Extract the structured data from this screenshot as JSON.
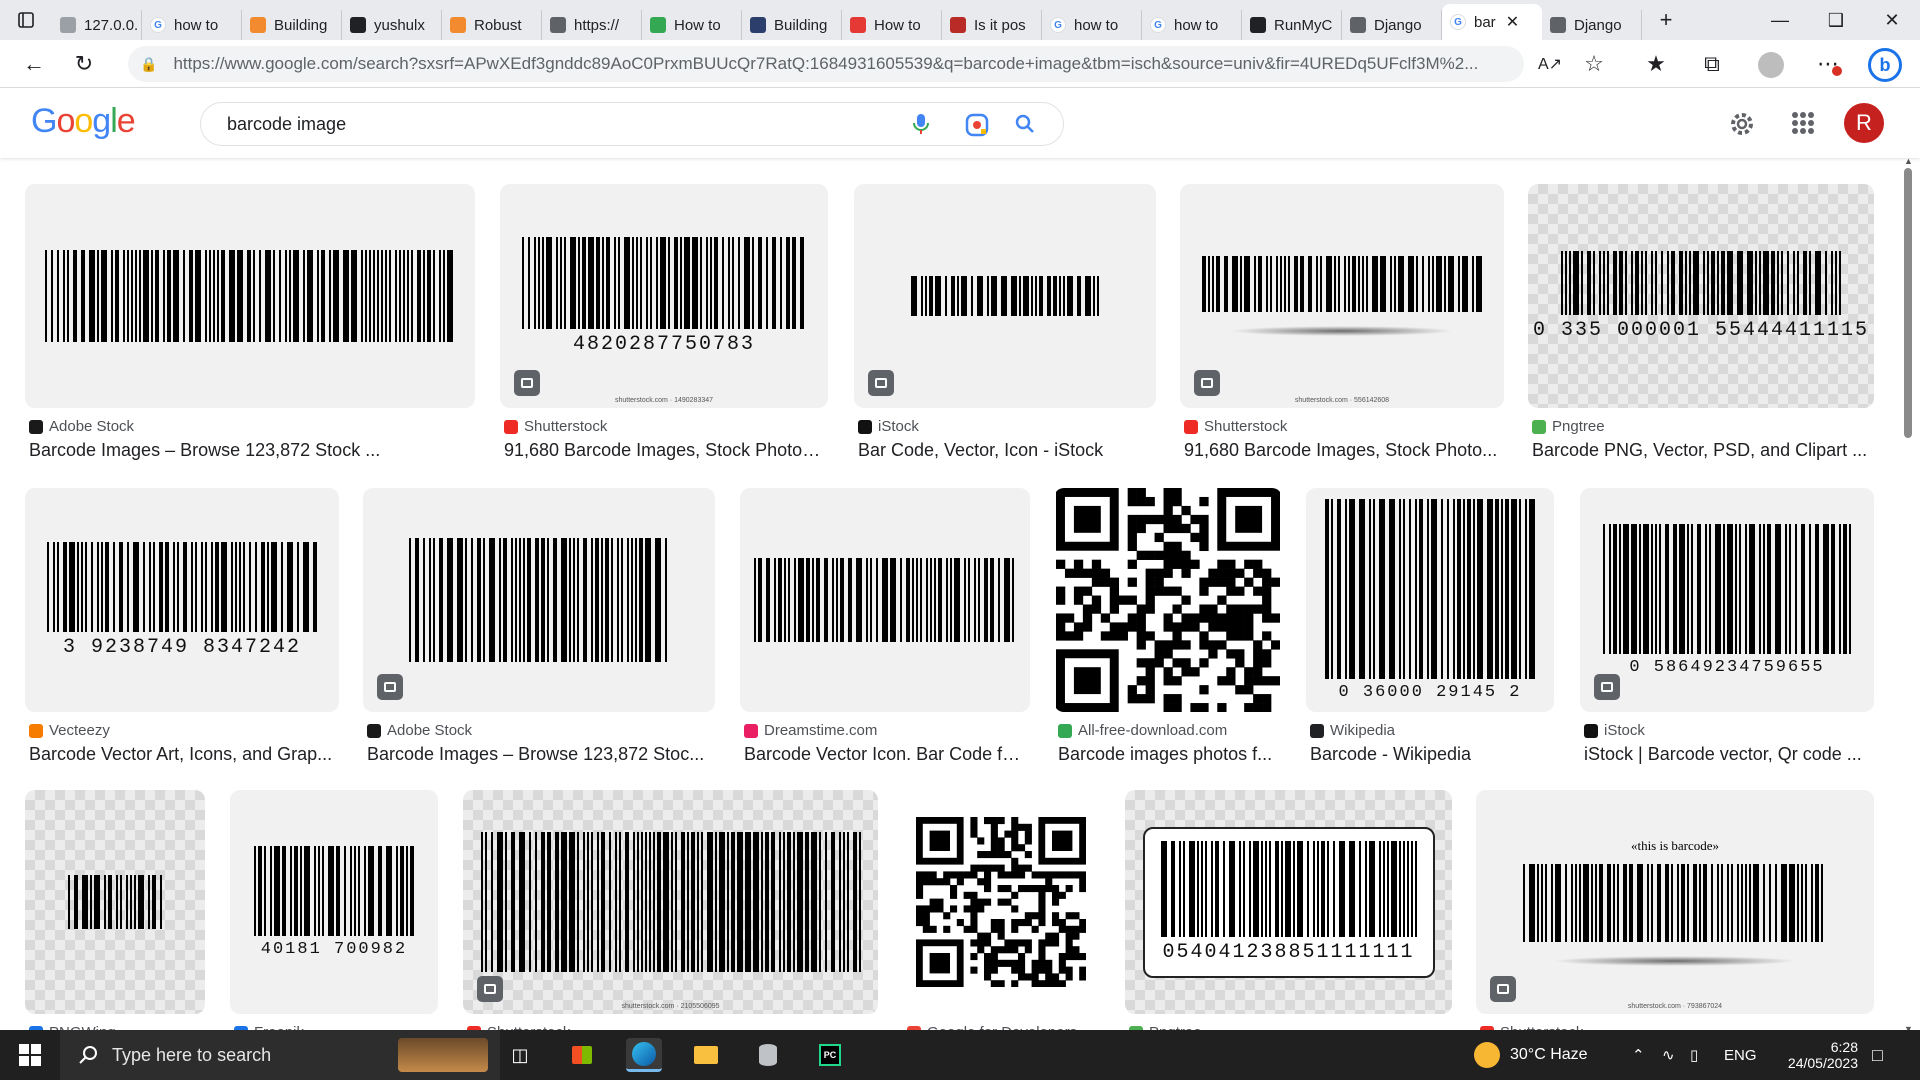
{
  "browser": {
    "tabs": [
      {
        "label": "127.0.0.",
        "icon": "local-icon",
        "color": "#9aa0a6"
      },
      {
        "label": "how to",
        "icon": "google-icon",
        "color": "#4285f4"
      },
      {
        "label": "Building",
        "icon": "diamond-icon",
        "color": "#f28b30"
      },
      {
        "label": "yushulx",
        "icon": "github-icon",
        "color": "#202124"
      },
      {
        "label": "Robust",
        "icon": "diamond-icon",
        "color": "#f28b30"
      },
      {
        "label": "https://",
        "icon": "page-icon",
        "color": "#5f6368"
      },
      {
        "label": "How to",
        "icon": "link-icon",
        "color": "#34a853"
      },
      {
        "label": "Building",
        "icon": "tds-icon",
        "color": "#2c3e6b"
      },
      {
        "label": "How to",
        "icon": "youtube-icon",
        "color": "#e53935"
      },
      {
        "label": "Is it pos",
        "icon": "quora-icon",
        "color": "#b92b27"
      },
      {
        "label": "how to",
        "icon": "google-icon",
        "color": "#4285f4"
      },
      {
        "label": "how to",
        "icon": "google-icon",
        "color": "#4285f4"
      },
      {
        "label": "RunMyC",
        "icon": "terminal-icon",
        "color": "#202124"
      },
      {
        "label": "Django",
        "icon": "page-icon",
        "color": "#5f6368"
      },
      {
        "label": "bar",
        "icon": "google-icon",
        "color": "#4285f4",
        "active": true
      },
      {
        "label": "Django",
        "icon": "page-icon",
        "color": "#5f6368"
      }
    ],
    "url": "https://www.google.com/search?sxsrf=APwXEdf3gnddc89AoC0PrxmBUUcQr7RatQ:1684931605539&q=barcode+image&tbm=isch&source=univ&fir=4UREDq5UFclf3M%2..."
  },
  "google": {
    "logo": "Google",
    "query": "barcode image",
    "avatar_letter": "R",
    "colors": {
      "blue": "#4285f4",
      "red": "#ea4335",
      "yellow": "#fbbc05",
      "green": "#34a853",
      "avatar": "#c5221f"
    }
  },
  "results": [
    {
      "source": "Adobe Stock",
      "source_color": "#1a1a1a",
      "title": "Barcode Images – Browse 123,872 Stock ...",
      "number": "",
      "watermark": ""
    },
    {
      "source": "Shutterstock",
      "source_color": "#ee2b24",
      "title": "91,680 Barcode Images, Stock Photos...",
      "number": "4820287750783",
      "watermark": "shutterstock.com · 1490283347"
    },
    {
      "source": "iStock",
      "source_color": "#111111",
      "title": "Bar Code, Vector, Icon - iStock",
      "number": "",
      "watermark": ""
    },
    {
      "source": "Shutterstock",
      "source_color": "#ee2b24",
      "title": "91,680 Barcode Images, Stock Photo...",
      "number": "",
      "watermark": "shutterstock.com · 556142608"
    },
    {
      "source": "Pngtree",
      "source_color": "#4caf50",
      "title": "Barcode PNG, Vector, PSD, and Clipart ...",
      "number": "0 335 000001 55444411115",
      "watermark": ""
    },
    {
      "source": "Vecteezy",
      "source_color": "#f57c00",
      "title": "Barcode Vector Art, Icons, and Grap...",
      "number": "3 9238749 8347242",
      "watermark": ""
    },
    {
      "source": "Adobe Stock",
      "source_color": "#1a1a1a",
      "title": "Barcode Images – Browse 123,872 Stoc...",
      "number": "",
      "watermark": ""
    },
    {
      "source": "Dreamstime.com",
      "source_color": "#e91e63",
      "title": "Barcode Vector Icon. Bar Code fo...",
      "number": "",
      "watermark": ""
    },
    {
      "source": "All-free-download.com",
      "source_color": "#34a853",
      "title": "Barcode images photos f...",
      "number": "",
      "watermark": ""
    },
    {
      "source": "Wikipedia",
      "source_color": "#202124",
      "title": "Barcode - Wikipedia",
      "number": "0 36000 29145 2",
      "watermark": ""
    },
    {
      "source": "iStock",
      "source_color": "#111111",
      "title": "iStock | Barcode vector, Qr code ...",
      "number": "0 58649234759655",
      "watermark": ""
    },
    {
      "source": "PNGWing",
      "source_color": "#1a73e8",
      "title": "",
      "number": "",
      "watermark": ""
    },
    {
      "source": "Freepik",
      "source_color": "#1a73e8",
      "title": "",
      "number": "40181 700982",
      "watermark": ""
    },
    {
      "source": "Shutterstock",
      "source_color": "#ee2b24",
      "title": "",
      "number": "",
      "watermark": "shutterstock.com · 2105506095"
    },
    {
      "source": "Google for Developers",
      "source_color": "#ea4335",
      "title": "",
      "number": "",
      "watermark": ""
    },
    {
      "source": "Pngtree",
      "source_color": "#4caf50",
      "title": "",
      "number": "054041238851111111",
      "watermark": ""
    },
    {
      "source": "Shutterstock",
      "source_color": "#ee2b24",
      "title": "",
      "number": "«this is barcode»",
      "watermark": "shutterstock.com · 793867024"
    }
  ],
  "taskbar": {
    "search_placeholder": "Type here to search",
    "weather": "30°C Haze",
    "language": "ENG",
    "time": "6:28",
    "date": "24/05/2023"
  }
}
